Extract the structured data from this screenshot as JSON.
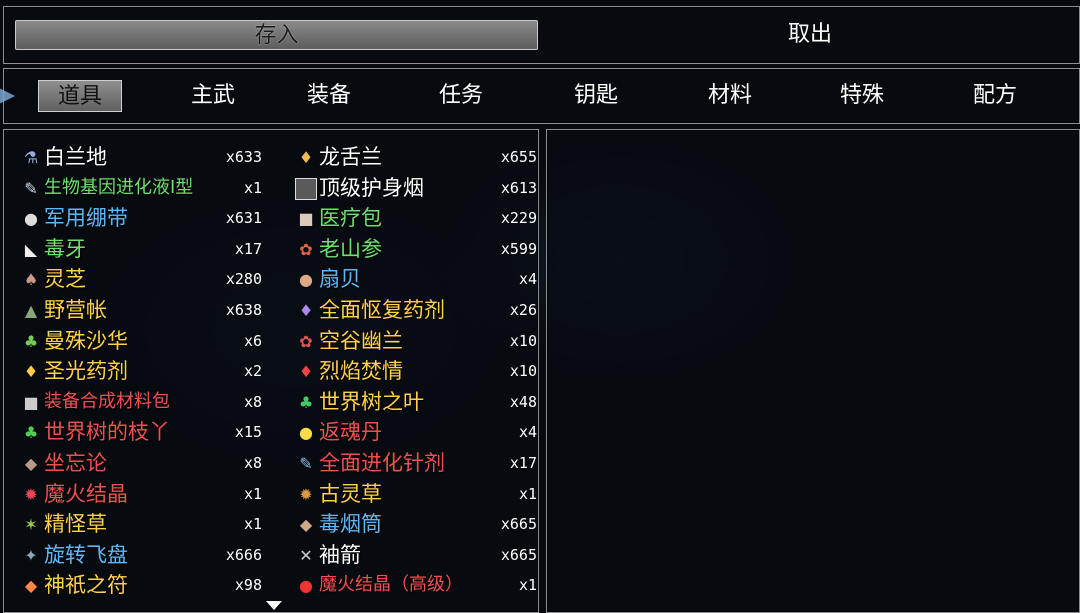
{
  "commands": {
    "deposit": "存入",
    "withdraw": "取出"
  },
  "categories": [
    {
      "label": "道具",
      "selected": true
    },
    {
      "label": "主武",
      "selected": false
    },
    {
      "label": "装备",
      "selected": false
    },
    {
      "label": "任务",
      "selected": false
    },
    {
      "label": "钥匙",
      "selected": false
    },
    {
      "label": "材料",
      "selected": false
    },
    {
      "label": "特殊",
      "selected": false
    },
    {
      "label": "配方",
      "selected": false
    }
  ],
  "items_left": [
    {
      "name": "白兰地",
      "count": "x633",
      "color": "#ffffff",
      "icon": "flask-icon"
    },
    {
      "name": "生物基因进化液Ⅰ型",
      "count": "x1",
      "color": "#6ee06e",
      "icon": "syringe-icon"
    },
    {
      "name": "军用绷带",
      "count": "x631",
      "color": "#5fb8f5",
      "icon": "bandage-icon"
    },
    {
      "name": "毒牙",
      "count": "x17",
      "color": "#6ee06e",
      "icon": "fang-icon"
    },
    {
      "name": "灵芝",
      "count": "x280",
      "color": "#ffd24a",
      "icon": "mushroom-icon"
    },
    {
      "name": "野营帐",
      "count": "x638",
      "color": "#ffd24a",
      "icon": "tent-icon"
    },
    {
      "name": "曼殊沙华",
      "count": "x6",
      "color": "#ffd24a",
      "icon": "potion-green-icon"
    },
    {
      "name": "圣光药剂",
      "count": "x2",
      "color": "#ffd24a",
      "icon": "potion-yellow-icon"
    },
    {
      "name": "装备合成材料包",
      "count": "x8",
      "color": "#f05050",
      "icon": "bag-icon"
    },
    {
      "name": "世界树的枝丫",
      "count": "x15",
      "color": "#f05050",
      "icon": "branch-icon"
    },
    {
      "name": "坐忘论",
      "count": "x8",
      "color": "#f05050",
      "icon": "book-icon"
    },
    {
      "name": "魔火结晶",
      "count": "x1",
      "color": "#f05050",
      "icon": "crystal-icon"
    },
    {
      "name": "精怪草",
      "count": "x1",
      "color": "#ffd24a",
      "icon": "herb-icon"
    },
    {
      "name": "旋转飞盘",
      "count": "x666",
      "color": "#5fb8f5",
      "icon": "shuriken-icon"
    },
    {
      "name": "神祇之符",
      "count": "x98",
      "color": "#ffd24a",
      "icon": "talisman-icon"
    }
  ],
  "items_right": [
    {
      "name": "龙舌兰",
      "count": "x655",
      "color": "#ffffff",
      "icon": "bottle-icon"
    },
    {
      "name": "顶级护身烟",
      "count": "x613",
      "color": "#ffffff",
      "icon": "blank-box-icon"
    },
    {
      "name": "医疗包",
      "count": "x229",
      "color": "#6ee06e",
      "icon": "medkit-icon"
    },
    {
      "name": "老山参",
      "count": "x599",
      "color": "#6ee06e",
      "icon": "ginseng-icon"
    },
    {
      "name": "扇贝",
      "count": "x4",
      "color": "#5fb8f5",
      "icon": "shell-icon"
    },
    {
      "name": "全面怄复药剂",
      "count": "x26",
      "color": "#ffd24a",
      "icon": "potion-purple-icon"
    },
    {
      "name": "空谷幽兰",
      "count": "x10",
      "color": "#ffd24a",
      "icon": "orchid-icon"
    },
    {
      "name": "烈焰焚情",
      "count": "x10",
      "color": "#ffd24a",
      "icon": "potion-red-icon"
    },
    {
      "name": "世界树之叶",
      "count": "x48",
      "color": "#ffd24a",
      "icon": "leaf-icon"
    },
    {
      "name": "返魂丹",
      "count": "x4",
      "color": "#f05050",
      "icon": "pill-icon"
    },
    {
      "name": "全面进化针剂",
      "count": "x17",
      "color": "#f05050",
      "icon": "injector-icon"
    },
    {
      "name": "古灵草",
      "count": "x1",
      "color": "#ffd24a",
      "icon": "grass-icon"
    },
    {
      "name": "毒烟筒",
      "count": "x665",
      "color": "#5fb8f5",
      "icon": "smoke-tube-icon"
    },
    {
      "name": "袖箭",
      "count": "x665",
      "color": "#ffffff",
      "icon": "arrows-icon"
    },
    {
      "name": "魔火结晶（高级）",
      "count": "x1",
      "color": "#f05050",
      "icon": "orb-icon"
    }
  ]
}
